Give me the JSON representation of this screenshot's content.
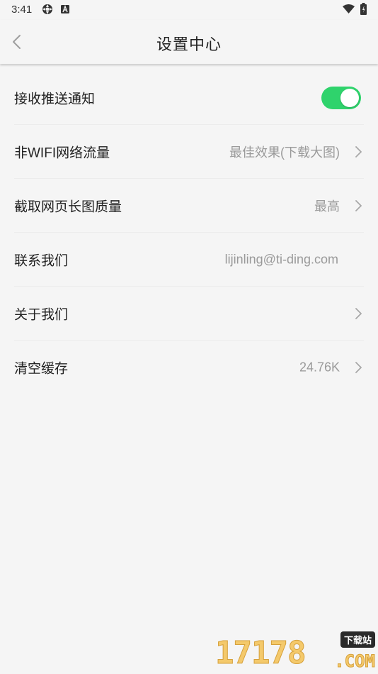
{
  "status_bar": {
    "time": "3:41",
    "icons": [
      "settings-cog-icon",
      "a-badge-icon",
      "wifi-icon",
      "battery-icon"
    ]
  },
  "header": {
    "title": "设置中心",
    "back_icon": "chevron-left-icon"
  },
  "settings": {
    "items": [
      {
        "label": "接收推送通知",
        "type": "toggle",
        "enabled": true
      },
      {
        "label": "非WIFI网络流量",
        "value": "最佳效果(下载大图)",
        "arrow": true
      },
      {
        "label": "截取网页长图质量",
        "value": "最高",
        "arrow": true
      },
      {
        "label": "联系我们",
        "value": "lijinling@ti-ding.com",
        "arrow": false
      },
      {
        "label": "关于我们",
        "value": "",
        "arrow": true
      },
      {
        "label": "清空缓存",
        "value": "24.76K",
        "arrow": true
      }
    ]
  },
  "watermark": {
    "digits": "17178",
    "tag": "下载站",
    "suffix": ".COM"
  },
  "colors": {
    "background": "#f5f5f5",
    "toggle_on": "#2fd36c",
    "value_text": "#9a9a9a",
    "chevron": "#a8a8a8"
  }
}
